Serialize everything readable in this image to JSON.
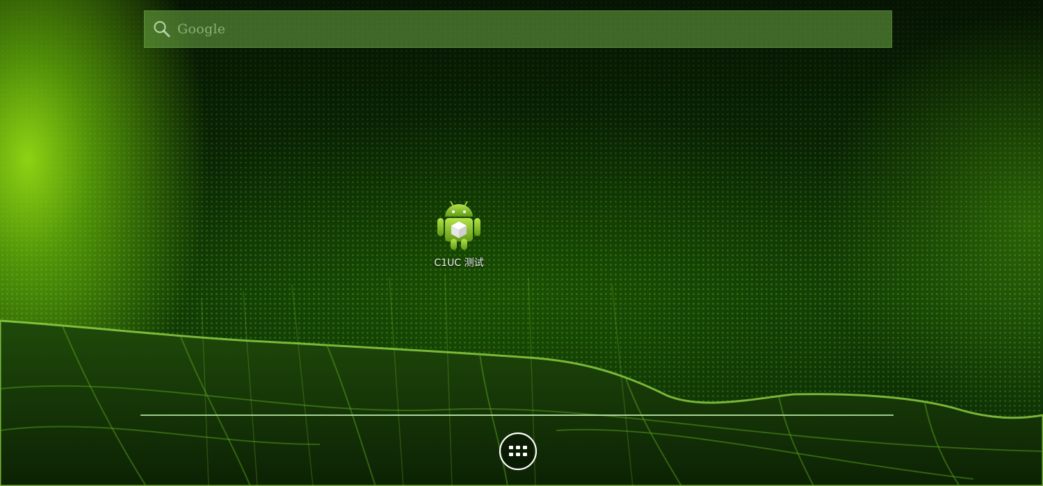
{
  "search": {
    "placeholder": "Google",
    "icon": "search-icon"
  },
  "shortcuts": [
    {
      "label": "C1UC 测试",
      "icon": "android-app-icon"
    }
  ],
  "dock": {
    "all_apps_icon": "all-apps-icon"
  },
  "colors": {
    "wallpaper_accent": "#7ed321",
    "search_bar_bg": "#6eaa46"
  }
}
